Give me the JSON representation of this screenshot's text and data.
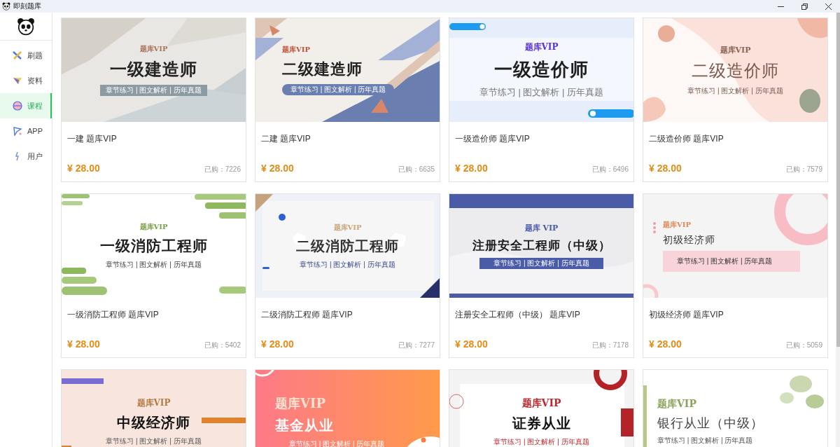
{
  "window": {
    "title": "即刻题库"
  },
  "sidebar": {
    "items": [
      {
        "label": "刷题",
        "selected": false
      },
      {
        "label": "资料",
        "selected": false
      },
      {
        "label": "课程",
        "selected": true
      },
      {
        "label": "APP",
        "selected": false
      },
      {
        "label": "用户",
        "selected": false
      }
    ]
  },
  "courses": [
    {
      "cover": {
        "kind": "brush",
        "badge": "题库VIP",
        "title": "一级建造师",
        "subtitle": "章节练习 | 图文解析 | 历年真题"
      },
      "name": "一建 题库VIP",
      "price": "¥ 28.00",
      "sold": "已购：7226"
    },
    {
      "cover": {
        "kind": "triangles",
        "badge": "题库VIP",
        "title": "二级建造师",
        "subtitle": "章节练习 | 图文解析 | 历年真题"
      },
      "name": "二建 题库VIP",
      "price": "¥ 28.00",
      "sold": "已购：6635"
    },
    {
      "cover": {
        "kind": "tech",
        "badge": "题库VIP",
        "title": "一级造价师",
        "subtitle": "章节练习 | 图文解析 | 历年真题"
      },
      "name": "一级造价师 题库VIP",
      "price": "¥ 28.00",
      "sold": "已购：6496"
    },
    {
      "cover": {
        "kind": "floral",
        "badge": "题库VIP",
        "title": "二级造价师",
        "subtitle": "章节练习 | 图文解析 | 历年真题"
      },
      "name": "二级造价师 题库VIP",
      "price": "¥ 28.00",
      "sold": "已购：7579"
    },
    {
      "cover": {
        "kind": "greenbrush",
        "badge": "题库VIP",
        "title": "一级消防工程师",
        "subtitle": "章节练习 | 图文解析 | 历年真题"
      },
      "name": "一级消防工程师 题库VIP",
      "price": "¥ 28.00",
      "sold": "已购：5402"
    },
    {
      "cover": {
        "kind": "pentagon",
        "badge": "题库VIP",
        "title": "二级消防工程师",
        "subtitle": "章节练习 | 图文解析 | 历年真题"
      },
      "name": "二级消防工程师 题库VIP",
      "price": "¥ 28.00",
      "sold": "已购：7277"
    },
    {
      "cover": {
        "kind": "bands",
        "badge": "题库 VIP",
        "title": "注册安全工程师（中级）",
        "subtitle": "章节练习 | 图文解析 | 历年真题"
      },
      "name": "注册安全工程师（中级） 题库VIP",
      "price": "¥ 28.00",
      "sold": "已购：7178"
    },
    {
      "cover": {
        "kind": "ring",
        "badge": "题库VIP",
        "title": "初级经济师",
        "subtitle": "章节练习 | 图文解析 | 历年真题"
      },
      "name": "初级经济师 题库VIP",
      "price": "¥ 28.00",
      "sold": "已购：5059"
    },
    {
      "cover": {
        "kind": "peach",
        "badge": "题库VIP",
        "title": "中级经济师",
        "subtitle": "章节练习 | 图文解析 | 历年真题"
      }
    },
    {
      "cover": {
        "kind": "gradient",
        "badge": "题库VIP",
        "title": "基金从业",
        "subtitle": "章节练习 | 图文解析 | 历年真题"
      }
    },
    {
      "cover": {
        "kind": "redframe",
        "badge": "题库VIP",
        "title": "证券从业",
        "subtitle": "章节练习 | 图文解析 | 历年真题"
      }
    },
    {
      "cover": {
        "kind": "leaf",
        "badge": "题库VIP",
        "title": "银行从业（中级）",
        "subtitle": "章节练习 | 图文解析 | 历年真题"
      }
    }
  ]
}
